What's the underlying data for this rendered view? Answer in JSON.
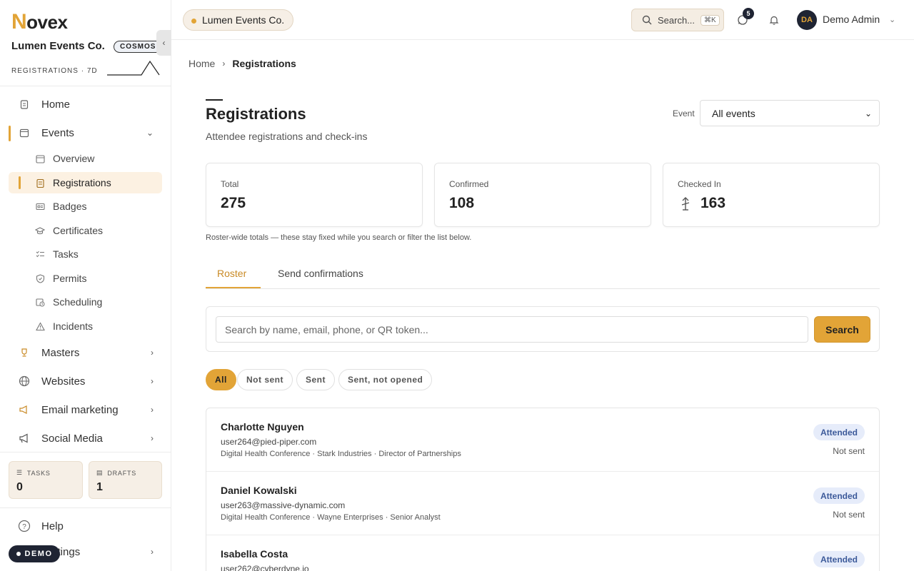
{
  "brand": {
    "initial": "N",
    "rest": "ovex"
  },
  "org": {
    "name": "Lumen Events Co.",
    "badge": "COSMOS"
  },
  "sidebar_summary": {
    "label": "REGISTRATIONS · 7D"
  },
  "nav": {
    "home": "Home",
    "events": "Events",
    "events_sub": {
      "overview": "Overview",
      "registrations": "Registrations",
      "badges": "Badges",
      "certificates": "Certificates",
      "tasks": "Tasks",
      "permits": "Permits",
      "scheduling": "Scheduling",
      "incidents": "Incidents"
    },
    "masters": "Masters",
    "websites": "Websites",
    "email_marketing": "Email marketing",
    "social_media": "Social Media",
    "help": "Help",
    "settings": "Settings"
  },
  "side_stats": {
    "tasks": {
      "label": "TASKS",
      "value": "0"
    },
    "drafts": {
      "label": "DRAFTS",
      "value": "1"
    }
  },
  "demo_pill": "DEMO",
  "topbar": {
    "org_chip": "Lumen Events Co.",
    "search_label": "Search...",
    "search_kbd": "⌘K",
    "messages_badge": "5",
    "user_initials": "DA",
    "user_name": "Demo Admin"
  },
  "breadcrumb": {
    "home": "Home",
    "current": "Registrations"
  },
  "page": {
    "title": "Registrations",
    "subtitle": "Attendee registrations and check-ins",
    "event_label": "Event",
    "event_selected": "All events"
  },
  "kpis": {
    "total": {
      "label": "Total",
      "value": "275"
    },
    "confirmed": {
      "label": "Confirmed",
      "value": "108"
    },
    "checked_in": {
      "label": "Checked In",
      "value": "163"
    },
    "note": "Roster-wide totals — these stay fixed while you search or filter the list below."
  },
  "tabs": {
    "roster": "Roster",
    "send": "Send confirmations"
  },
  "search": {
    "placeholder": "Search by name, email, phone, or QR token...",
    "button": "Search"
  },
  "filters": {
    "all": "All",
    "not_sent": "Not sent",
    "sent": "Sent",
    "sent_not_opened": "Sent, not opened"
  },
  "rows": [
    {
      "name": "Charlotte Nguyen",
      "email": "user264@pied-piper.com",
      "meta": "Digital Health Conference · Stark Industries · Director of Partnerships",
      "status": "Attended",
      "sent": "Not sent"
    },
    {
      "name": "Daniel Kowalski",
      "email": "user263@massive-dynamic.com",
      "meta": "Digital Health Conference · Wayne Enterprises · Senior Analyst",
      "status": "Attended",
      "sent": "Not sent"
    },
    {
      "name": "Isabella Costa",
      "email": "user262@cyberdyne.io",
      "meta": "",
      "status": "Attended",
      "sent": ""
    }
  ],
  "colors": {
    "accent": "#e2a437",
    "dark": "#1f2433",
    "status_bg": "#e6ecfa",
    "status_text": "#3c5a9a"
  }
}
